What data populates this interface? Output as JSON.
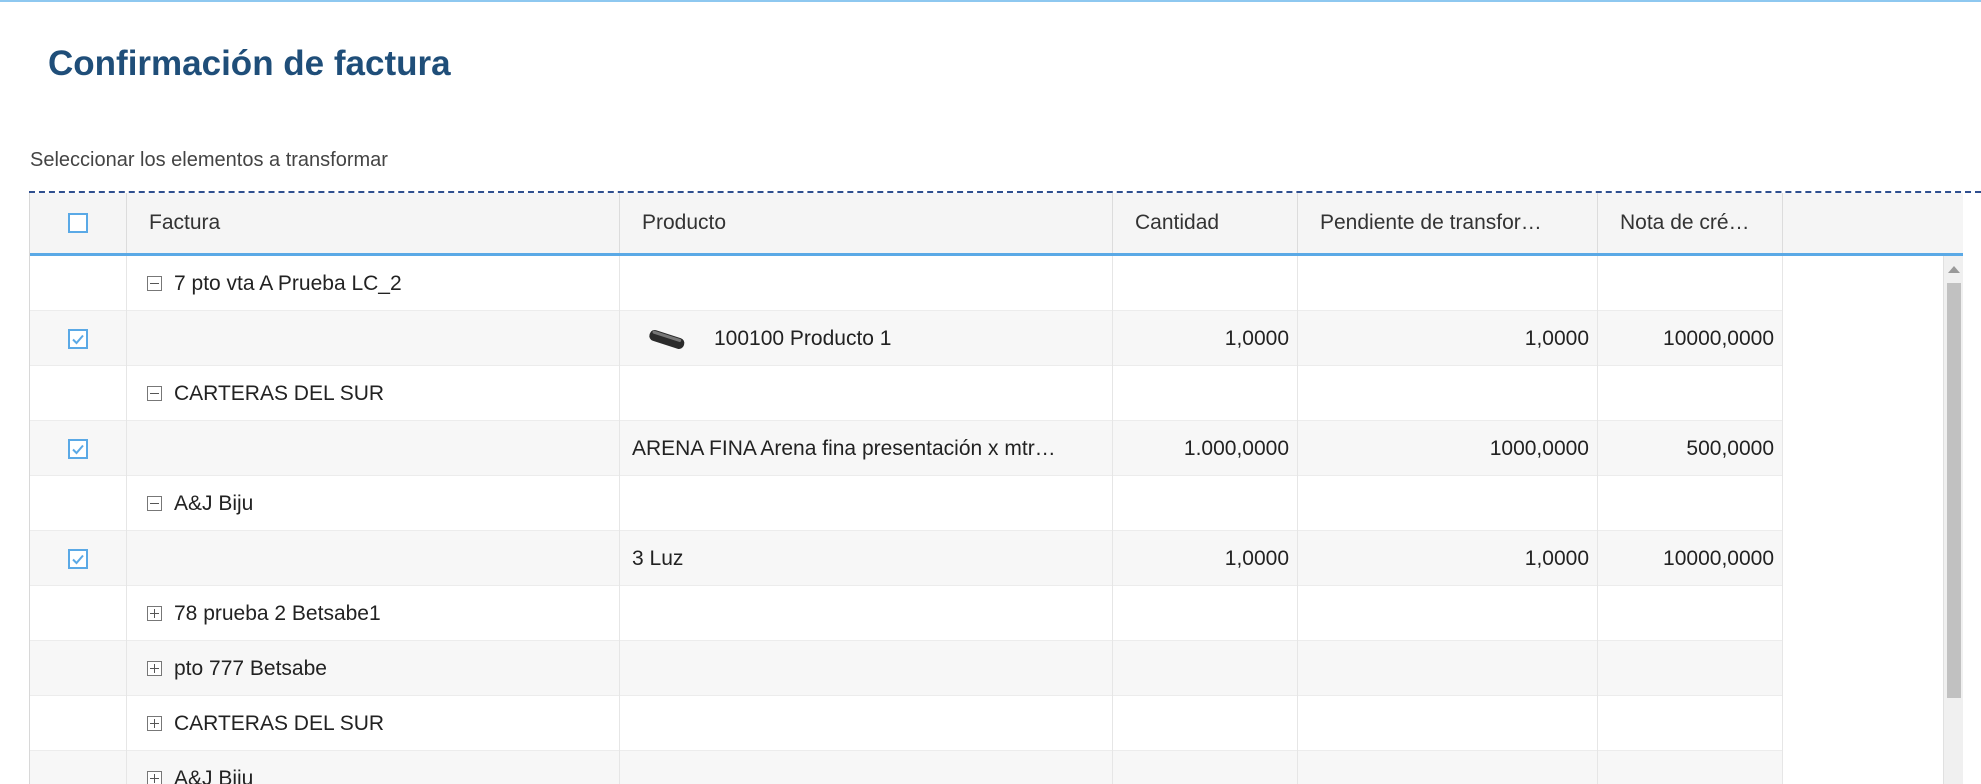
{
  "page": {
    "title": "Confirmación de factura",
    "instruction": "Seleccionar los elementos a transformar"
  },
  "colors": {
    "title": "#1f4e79",
    "accent": "#5aa9e6",
    "header_bg": "#f5f5f5"
  },
  "table": {
    "headers": {
      "factura": "Factura",
      "producto": "Producto",
      "cantidad": "Cantidad",
      "pendiente": "Pendiente de transfor…",
      "nota": "Nota de cré…"
    },
    "rows": [
      {
        "type": "group",
        "expanded": true,
        "factura": "7 pto vta A Prueba LC_2"
      },
      {
        "type": "item",
        "checked": true,
        "producto": "100100 Producto 1",
        "has_thumb": true,
        "cantidad": "1,0000",
        "pendiente": "1,0000",
        "nota": "10000,0000"
      },
      {
        "type": "group",
        "expanded": true,
        "factura": "CARTERAS DEL SUR"
      },
      {
        "type": "item",
        "checked": true,
        "producto": "ARENA FINA Arena fina presentación x mtr…",
        "has_thumb": false,
        "cantidad": "1.000,0000",
        "pendiente": "1000,0000",
        "nota": "500,0000"
      },
      {
        "type": "group",
        "expanded": true,
        "factura": "A&J Biju"
      },
      {
        "type": "item",
        "checked": true,
        "producto": "3 Luz",
        "has_thumb": false,
        "cantidad": "1,0000",
        "pendiente": "1,0000",
        "nota": "10000,0000"
      },
      {
        "type": "group",
        "expanded": false,
        "factura": "78 prueba 2 Betsabe1"
      },
      {
        "type": "group",
        "expanded": false,
        "factura": "pto 777 Betsabe"
      },
      {
        "type": "group",
        "expanded": false,
        "factura": "CARTERAS DEL SUR"
      },
      {
        "type": "group",
        "expanded": false,
        "factura": "A&J Biju"
      }
    ]
  }
}
